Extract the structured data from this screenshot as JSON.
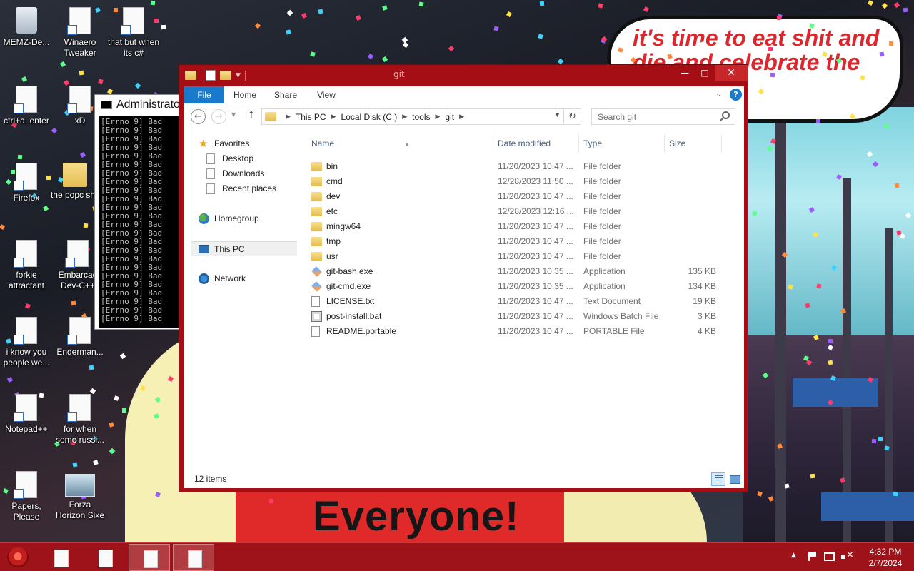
{
  "wallpaper": {
    "bubble_text": "it's time to eat shit and die and celebrate the new year",
    "big_text": "Everyone!"
  },
  "desktop_icons": [
    {
      "label": "MEMZ-De...",
      "icon": "recycle-bin-icon"
    },
    {
      "label": "Winaero Tweaker",
      "icon": "shortcut-icon"
    },
    {
      "label": "that but when its c#",
      "icon": "shortcut-icon"
    },
    {
      "label": "ctrl+a, enter",
      "icon": "shortcut-icon"
    },
    {
      "label": "xD",
      "icon": "shortcut-icon"
    },
    {
      "label": "Firefox",
      "icon": "shortcut-icon"
    },
    {
      "label": "the popc shit",
      "icon": "folder-icon"
    },
    {
      "label": "forkie attractant",
      "icon": "shortcut-icon"
    },
    {
      "label": "Embarcad Dev-C++",
      "icon": "shortcut-icon"
    },
    {
      "label": "i know you people we...",
      "icon": "shortcut-icon"
    },
    {
      "label": "Enderman...",
      "icon": "shortcut-icon"
    },
    {
      "label": "Notepad++",
      "icon": "shortcut-icon"
    },
    {
      "label": "for when some russi...",
      "icon": "shortcut-icon"
    },
    {
      "label": "Papers, Please",
      "icon": "shortcut-icon"
    },
    {
      "label": "Forza Horizon Sixe",
      "icon": "image-icon"
    }
  ],
  "cmd_window": {
    "title": "Administrato",
    "lines": [
      "[Errno 9] Bad",
      "[Errno 9] Bad",
      "[Errno 9] Bad",
      "[Errno 9] Bad",
      "[Errno 9] Bad",
      "[Errno 9] Bad",
      "[Errno 9] Bad",
      "[Errno 9] Bad",
      "[Errno 9] Bad",
      "[Errno 9] Bad",
      "[Errno 9] Bad",
      "[Errno 9] Bad",
      "[Errno 9] Bad",
      "[Errno 9] Bad",
      "[Errno 9] Bad",
      "[Errno 9] Bad",
      "[Errno 9] Bad",
      "[Errno 9] Bad",
      "[Errno 9] Bad",
      "[Errno 9] Bad",
      "[Errno 9] Bad",
      "[Errno 9] Bad",
      "[Errno 9] Bad",
      "[Errno 9] Bad"
    ]
  },
  "explorer": {
    "title": "git",
    "window_buttons": {
      "minimize": "—",
      "maximize": "□",
      "close": "✕"
    },
    "ribbon_tabs": [
      "File",
      "Home",
      "Share",
      "View"
    ],
    "help_label": "?",
    "breadcrumb": [
      "This PC",
      "Local Disk (C:)",
      "tools",
      "git"
    ],
    "search_placeholder": "Search git",
    "nav_pane": {
      "favorites": "Favorites",
      "favorites_items": [
        "Desktop",
        "Downloads",
        "Recent places"
      ],
      "homegroup": "Homegroup",
      "this_pc": "This PC",
      "network": "Network"
    },
    "columns": {
      "name": "Name",
      "date": "Date modified",
      "type": "Type",
      "size": "Size"
    },
    "files": [
      {
        "name": "bin",
        "date": "11/20/2023 10:47 ...",
        "type": "File folder",
        "size": "",
        "icon": "folder-icon"
      },
      {
        "name": "cmd",
        "date": "12/28/2023 11:50 ...",
        "type": "File folder",
        "size": "",
        "icon": "folder-icon"
      },
      {
        "name": "dev",
        "date": "11/20/2023 10:47 ...",
        "type": "File folder",
        "size": "",
        "icon": "folder-icon"
      },
      {
        "name": "etc",
        "date": "12/28/2023 12:16 ...",
        "type": "File folder",
        "size": "",
        "icon": "folder-icon"
      },
      {
        "name": "mingw64",
        "date": "11/20/2023 10:47 ...",
        "type": "File folder",
        "size": "",
        "icon": "folder-icon"
      },
      {
        "name": "tmp",
        "date": "11/20/2023 10:47 ...",
        "type": "File folder",
        "size": "",
        "icon": "folder-icon"
      },
      {
        "name": "usr",
        "date": "11/20/2023 10:47 ...",
        "type": "File folder",
        "size": "",
        "icon": "folder-icon"
      },
      {
        "name": "git-bash.exe",
        "date": "11/20/2023 10:35 ...",
        "type": "Application",
        "size": "135 KB",
        "icon": "git-exe-icon"
      },
      {
        "name": "git-cmd.exe",
        "date": "11/20/2023 10:35 ...",
        "type": "Application",
        "size": "134 KB",
        "icon": "git-exe-icon"
      },
      {
        "name": "LICENSE.txt",
        "date": "11/20/2023 10:47 ...",
        "type": "Text Document",
        "size": "19 KB",
        "icon": "text-file-icon"
      },
      {
        "name": "post-install.bat",
        "date": "11/20/2023 10:47 ...",
        "type": "Windows Batch File",
        "size": "3 KB",
        "icon": "batch-file-icon"
      },
      {
        "name": "README.portable",
        "date": "11/20/2023 10:47 ...",
        "type": "PORTABLE File",
        "size": "4 KB",
        "icon": "blank-file-icon"
      }
    ],
    "status": "12 items"
  },
  "taskbar": {
    "buttons": [
      {
        "icon": "document-icon",
        "active": false
      },
      {
        "icon": "document-icon",
        "active": false
      },
      {
        "icon": "document-icon",
        "active": true
      },
      {
        "icon": "document-icon",
        "active": true
      }
    ],
    "time": "4:32 PM",
    "date": "2/7/2024"
  }
}
